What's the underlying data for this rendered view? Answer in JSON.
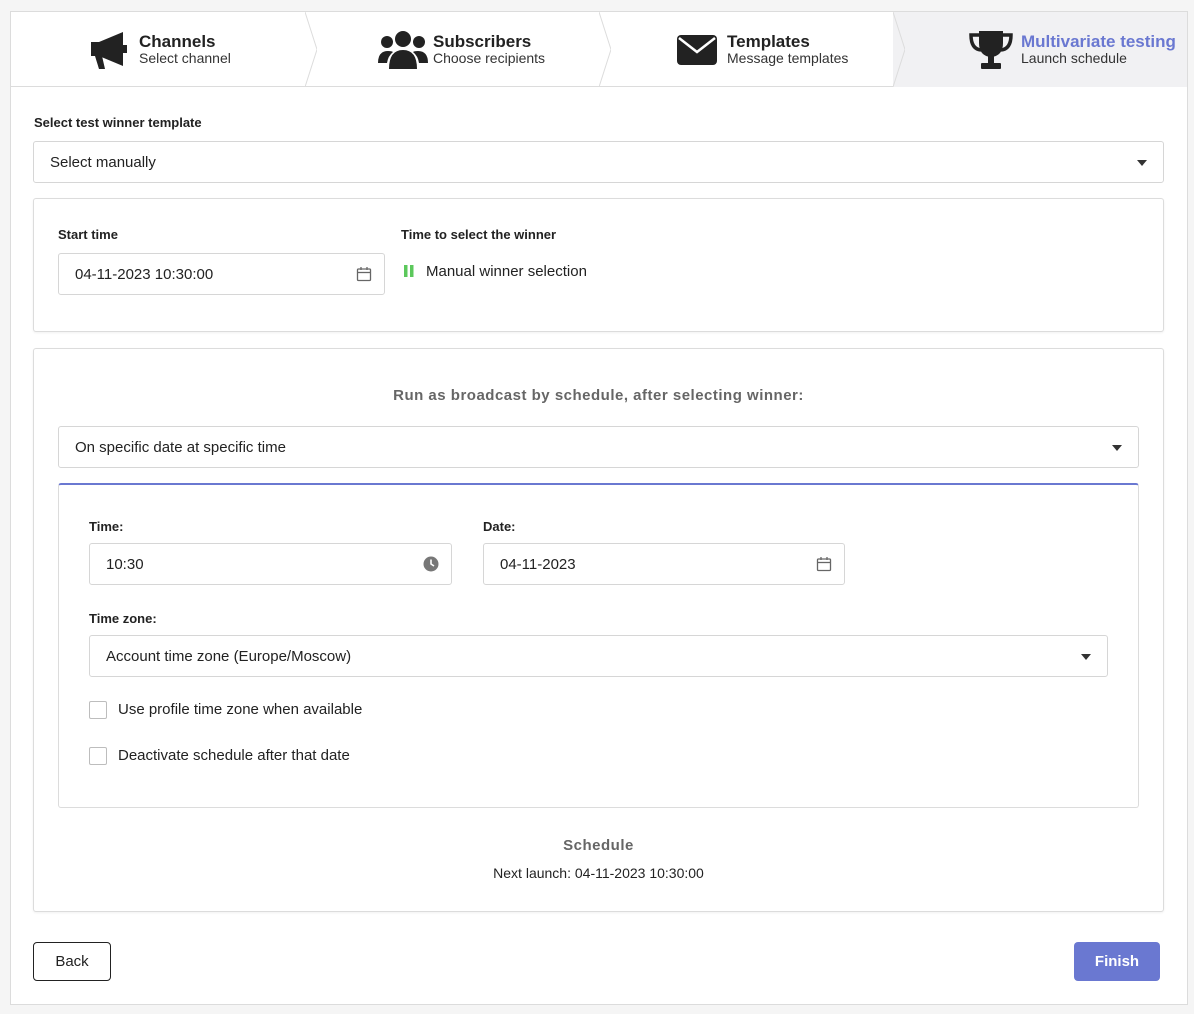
{
  "stepper": {
    "steps": [
      {
        "title": "Channels",
        "subtitle": "Select channel",
        "icon": "megaphone-icon"
      },
      {
        "title": "Subscribers",
        "subtitle": "Choose recipients",
        "icon": "users-icon"
      },
      {
        "title": "Templates",
        "subtitle": "Message templates",
        "icon": "envelope-icon"
      },
      {
        "title": "Multivariate testing",
        "subtitle": "Launch schedule",
        "icon": "trophy-icon"
      }
    ],
    "active_index": 3
  },
  "winner_template": {
    "label": "Select test winner template",
    "value": "Select manually"
  },
  "test_panel": {
    "start_time_label": "Start time",
    "start_time_value": "04-11-2023 10:30:00",
    "winner_time_label": "Time to select the winner",
    "winner_time_value": "Manual winner selection"
  },
  "broadcast_panel": {
    "heading": "Run as broadcast by schedule, after selecting winner:",
    "mode_value": "On specific date at specific time",
    "time_label": "Time:",
    "time_value": "10:30",
    "date_label": "Date:",
    "date_value": "04-11-2023",
    "timezone_label": "Time zone:",
    "timezone_value": "Account time zone (Europe/Moscow)",
    "checkbox_profile_tz": "Use profile time zone when available",
    "checkbox_deactivate": "Deactivate schedule after that date",
    "schedule_heading": "Schedule",
    "next_launch": "Next launch: 04-11-2023 10:30:00"
  },
  "footer": {
    "back_label": "Back",
    "finish_label": "Finish"
  },
  "colors": {
    "accent": "#6a78d1",
    "status_green": "#5cc85c"
  }
}
